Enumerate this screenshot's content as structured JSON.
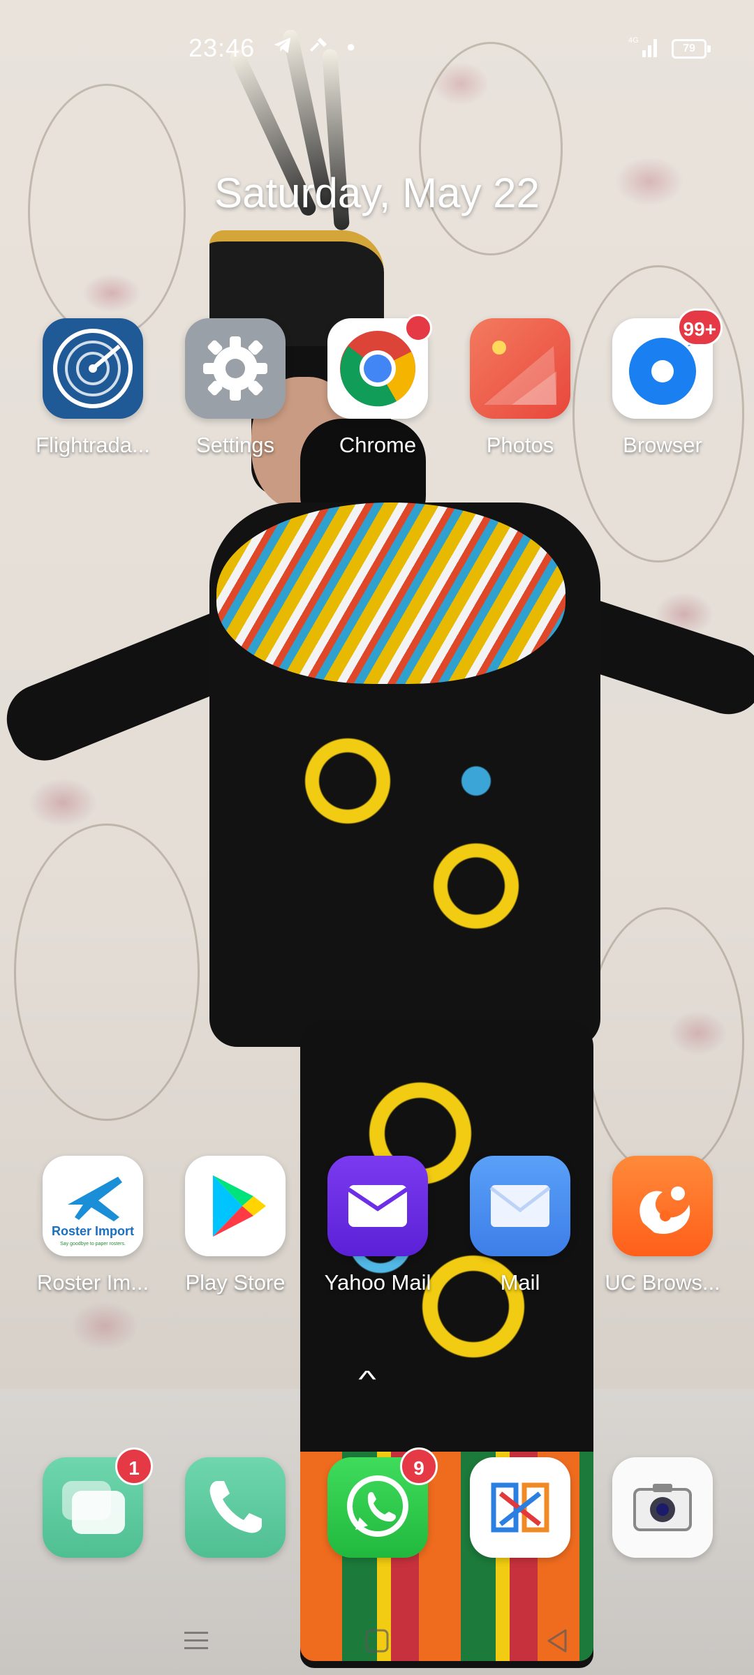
{
  "status_bar": {
    "time": "23:46",
    "network": "4G",
    "battery": "79"
  },
  "date": "Saturday, May 22",
  "apps_row1": [
    {
      "name": "Flightrada...",
      "icon": "flightradar-icon"
    },
    {
      "name": "Settings",
      "icon": "settings-gear-icon"
    },
    {
      "name": "Chrome",
      "icon": "chrome-icon"
    },
    {
      "name": "Photos",
      "icon": "photos-icon"
    },
    {
      "name": "Browser",
      "icon": "browser-icon",
      "badge": "99+"
    }
  ],
  "apps_row2": [
    {
      "name": "Roster Im...",
      "icon": "roster-import-icon",
      "icon_title": "Roster Import",
      "icon_subtitle": "Say goodbye to paper rosters."
    },
    {
      "name": "Play Store",
      "icon": "play-store-icon"
    },
    {
      "name": "Yahoo Mail",
      "icon": "yahoo-mail-icon"
    },
    {
      "name": "Mail",
      "icon": "mail-icon"
    },
    {
      "name": "UC Brows...",
      "icon": "uc-browser-icon"
    }
  ],
  "dock": [
    {
      "icon": "messages-icon",
      "badge": "1"
    },
    {
      "icon": "phone-icon"
    },
    {
      "icon": "whatsapp-icon",
      "badge": "9"
    },
    {
      "icon": "wps-office-icon"
    },
    {
      "icon": "camera-icon"
    }
  ],
  "colors": {
    "badge": "#e53945",
    "flightradar": "#1f5a96",
    "settings": "#9aa0a8",
    "photos": "#ef5a4a",
    "yahoo": "#6d2ee8",
    "mail": "#4e8ff0",
    "uc": "#ff6a1f",
    "whatsapp": "#29c34a",
    "dock_green": "#5fc9a0"
  }
}
